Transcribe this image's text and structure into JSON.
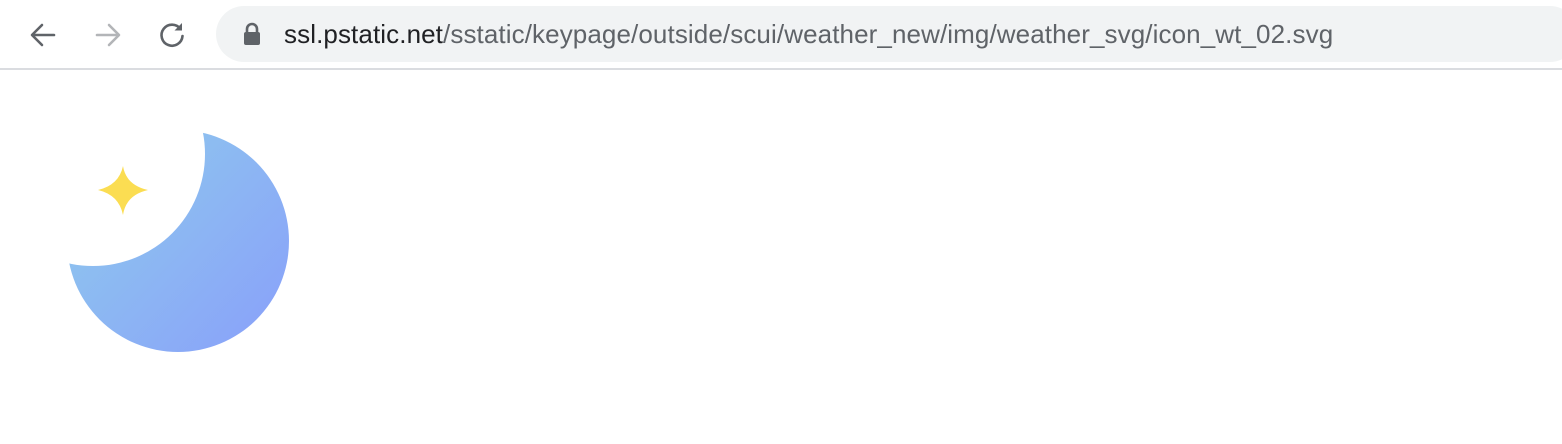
{
  "browser": {
    "nav": {
      "back_icon": "arrow-left-icon",
      "forward_icon": "arrow-right-icon",
      "reload_icon": "reload-icon"
    },
    "address_bar": {
      "security_icon": "lock-icon",
      "url_host": "ssl.pstatic.net",
      "url_path": "/sstatic/keypage/outside/scui/weather_new/img/weather_svg/icon_wt_02.svg"
    }
  },
  "content": {
    "image": {
      "icon": "crescent-moon-with-star-icon",
      "colors": {
        "moon_start": "#8ec5ee",
        "moon_end": "#8aa6f8",
        "star": "#fbdd52"
      }
    }
  }
}
